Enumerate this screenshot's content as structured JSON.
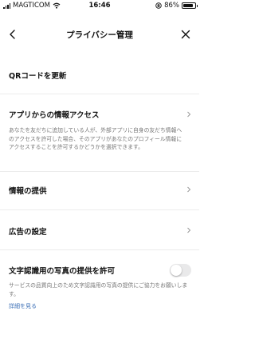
{
  "status_bar": {
    "carrier": "MAGTICOM",
    "time": "16:46",
    "battery_percent": "86%"
  },
  "header": {
    "title": "プライバシー管理"
  },
  "items": {
    "qr_update": {
      "label": "QRコードを更新"
    },
    "app_access": {
      "label": "アプリからの情報アクセス",
      "description": "あなたを友だちに追加している人が、外部アプリに自身の友だち情報へのアクセスを許可した場合、そのアプリがあなたのプロフィール情報にアクセスすることを許可するかどうかを選択できます。"
    },
    "info_provision": {
      "label": "情報の提供"
    },
    "ad_settings": {
      "label": "広告の設定"
    },
    "ocr_photos": {
      "label": "文字認識用の写真の提供を許可",
      "description": "サービスの品質向上のため文字認識用の写真の提供にご協力をお願いします。",
      "toggle_on": false,
      "details_link": "詳細を見る"
    }
  },
  "colors": {
    "link": "#3b6fb6",
    "divider": "#ececec",
    "toggle_off": "#e9e9ea"
  }
}
